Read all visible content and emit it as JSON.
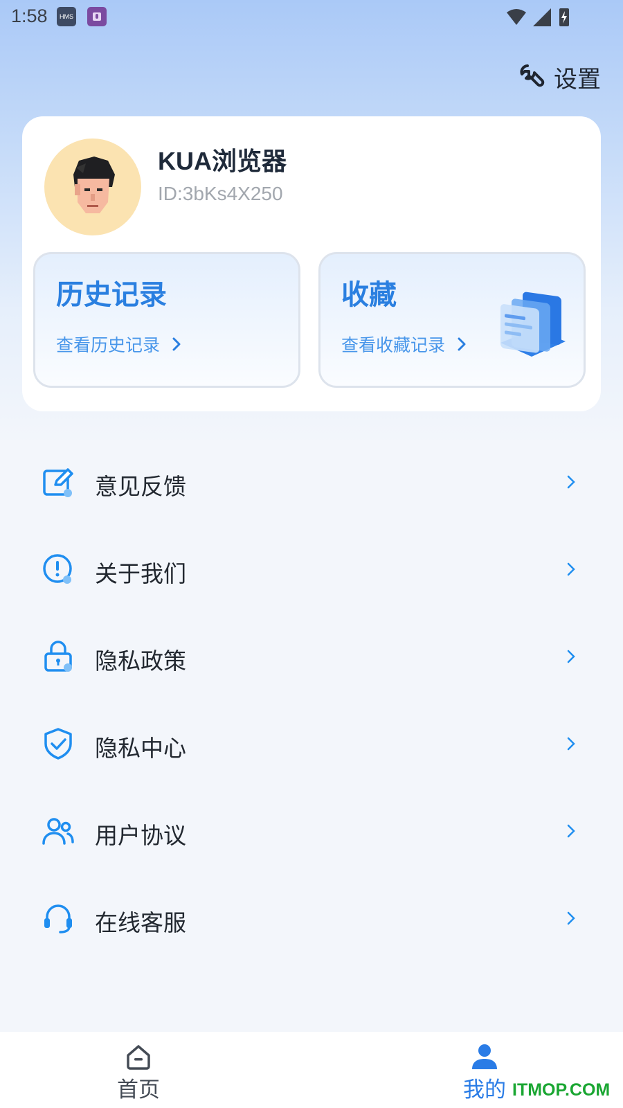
{
  "status_bar": {
    "time": "1:58",
    "hms_label": "HMS"
  },
  "header": {
    "settings_label": "设置"
  },
  "profile": {
    "name": "KUA浏览器",
    "id": "ID:3bKs4X250"
  },
  "quick_cards": [
    {
      "title": "历史记录",
      "subtitle": "查看历史记录"
    },
    {
      "title": "收藏",
      "subtitle": "查看收藏记录"
    }
  ],
  "menu": [
    {
      "label": "意见反馈",
      "icon": "edit-icon"
    },
    {
      "label": "关于我们",
      "icon": "info-icon"
    },
    {
      "label": "隐私政策",
      "icon": "lock-icon"
    },
    {
      "label": "隐私中心",
      "icon": "shield-icon"
    },
    {
      "label": "用户协议",
      "icon": "users-icon"
    },
    {
      "label": "在线客服",
      "icon": "headset-icon"
    }
  ],
  "bottom_nav": [
    {
      "label": "首页",
      "icon": "home-icon",
      "active": false
    },
    {
      "label": "我的",
      "icon": "user-icon",
      "active": true
    }
  ],
  "watermark": "ITMOP.COM",
  "colors": {
    "accent": "#2a7ce6",
    "icon_blue": "#1f8ef0"
  }
}
